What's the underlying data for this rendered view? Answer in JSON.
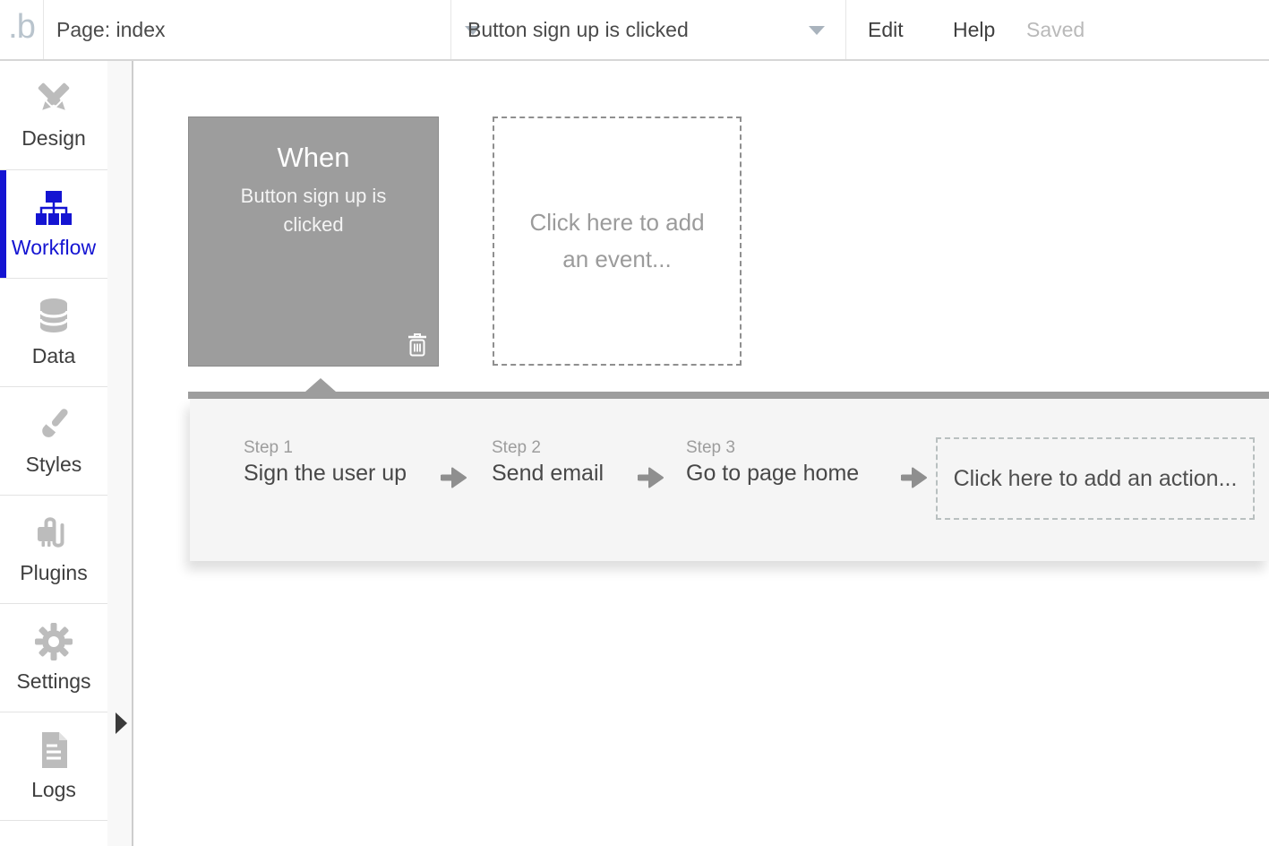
{
  "topbar": {
    "logo": ".b",
    "page_selector": "Page: index",
    "event_selector": "Button sign up is clicked",
    "edit_label": "Edit",
    "help_label": "Help",
    "saved_label": "Saved"
  },
  "sidebar": {
    "items": [
      {
        "label": "Design",
        "icon": "design-tools-icon",
        "active": false
      },
      {
        "label": "Workflow",
        "icon": "workflow-icon",
        "active": true
      },
      {
        "label": "Data",
        "icon": "database-icon",
        "active": false
      },
      {
        "label": "Styles",
        "icon": "paintbrush-icon",
        "active": false
      },
      {
        "label": "Plugins",
        "icon": "plug-icon",
        "active": false
      },
      {
        "label": "Settings",
        "icon": "gear-icon",
        "active": false
      },
      {
        "label": "Logs",
        "icon": "document-icon",
        "active": false
      }
    ]
  },
  "canvas": {
    "event_card": {
      "title": "When",
      "subtitle": "Button sign up is clicked"
    },
    "add_event_placeholder": "Click here to add an event..."
  },
  "action_panel": {
    "steps": [
      {
        "label": "Step 1",
        "action": "Sign the user up"
      },
      {
        "label": "Step 2",
        "action": "Send email"
      },
      {
        "label": "Step 3",
        "action": "Go to page home"
      }
    ],
    "add_action_placeholder": "Click here to add an action..."
  },
  "colors": {
    "accent_blue": "#1414d2",
    "event_card_gray": "#9d9d9d",
    "panel_background": "#f5f5f5",
    "icon_gray": "#bcbcbc"
  }
}
